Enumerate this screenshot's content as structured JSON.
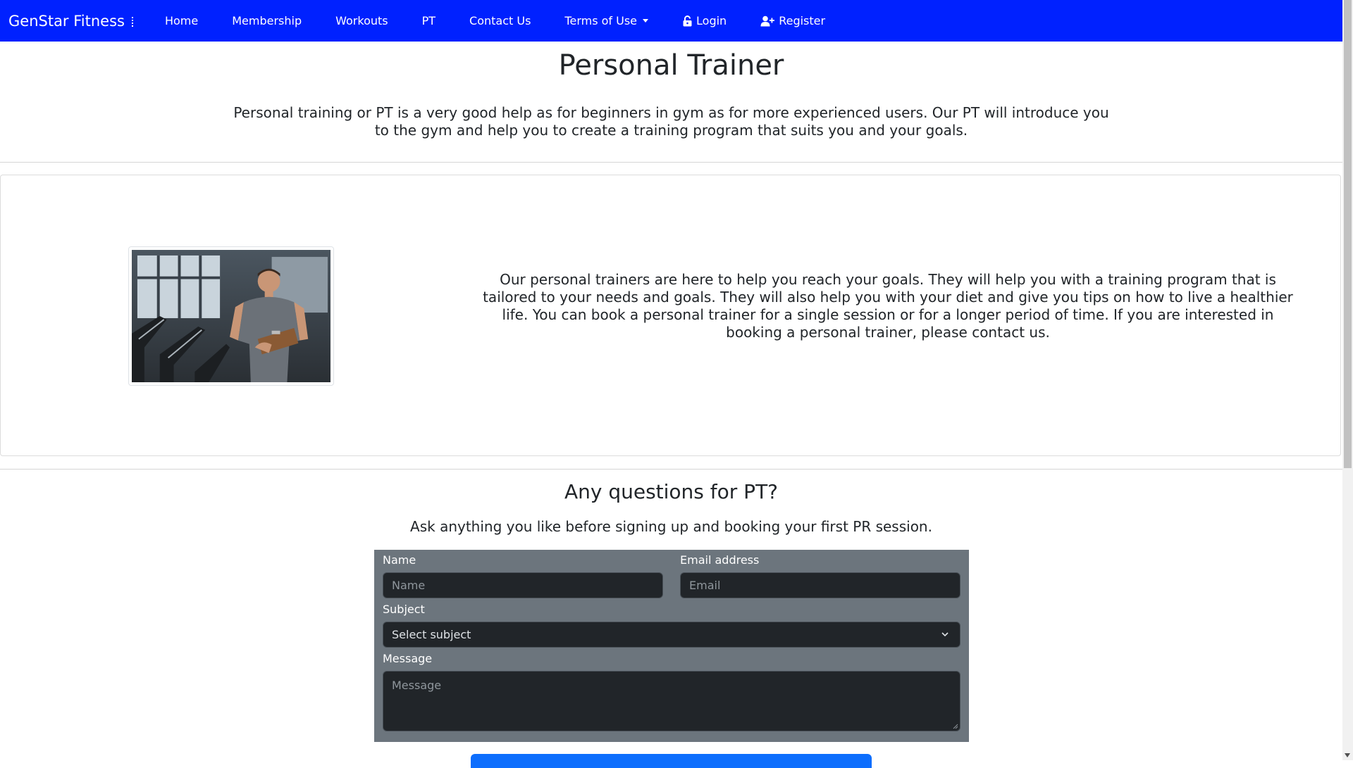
{
  "navbar": {
    "brand": "GenStar Fitness",
    "items": [
      {
        "label": "Home"
      },
      {
        "label": "Membership"
      },
      {
        "label": "Workouts"
      },
      {
        "label": "PT"
      },
      {
        "label": "Contact Us"
      },
      {
        "label": "Terms of Use"
      },
      {
        "label": "Login"
      },
      {
        "label": "Register"
      }
    ]
  },
  "header": {
    "title": "Personal Trainer",
    "intro": "Personal training or PT is a very good help as for beginners in gym as for more experienced users. Our PT will introduce you to the gym and help you to create a training program that suits you and your goals."
  },
  "card": {
    "text": "Our personal trainers are here to help you reach your goals. They will help you with a training program that is tailored to your needs and goals. They will also help you with your diet and give you tips on how to live a healthier life. You can book a personal trainer for a single session or for a longer period of time. If you are interested in booking a personal trainer, please contact us."
  },
  "contact": {
    "title": "Any questions for PT?",
    "subtitle": "Ask anything you like before signing up and booking your first PR session.",
    "name_label": "Name",
    "name_placeholder": "Name",
    "email_label": "Email address",
    "email_placeholder": "Email",
    "subject_label": "Subject",
    "subject_selected": "Select subject",
    "message_label": "Message",
    "message_placeholder": "Message"
  },
  "colors": {
    "navbar": "#0021ff",
    "form_bg": "#6c757d",
    "field_bg": "#212529",
    "button": "#0d6efd"
  }
}
